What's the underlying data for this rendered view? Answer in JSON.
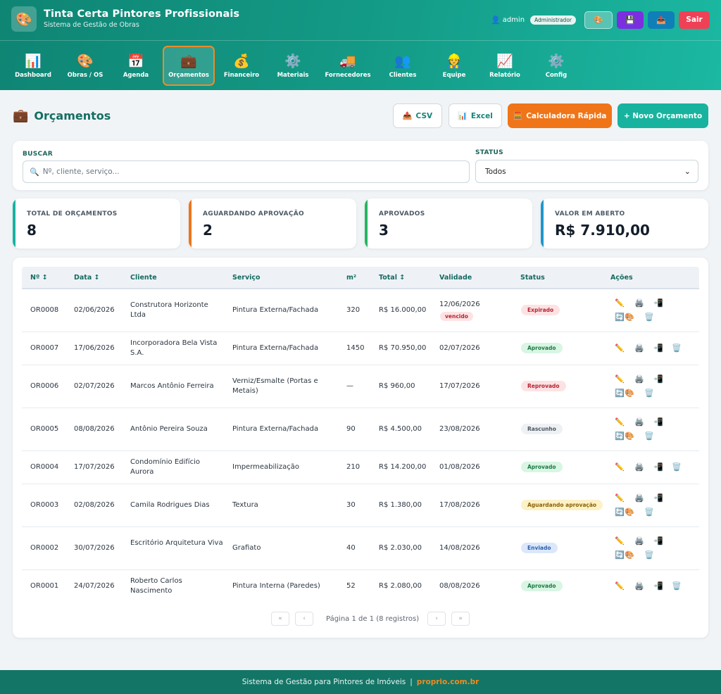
{
  "app": {
    "logo_icon": "🎨",
    "title": "Tinta Certa Pintores Profissionais",
    "subtitle": "Sistema de Gestão de Obras"
  },
  "user": {
    "icon": "👤",
    "name": "admin",
    "role": "Administrador"
  },
  "header_buttons": {
    "theme_icon": "🎨",
    "save_icon": "💾",
    "upload_icon": "📤",
    "exit_label": "Sair"
  },
  "nav": [
    {
      "icon": "📊",
      "label": "Dashboard"
    },
    {
      "icon": "🎨",
      "label": "Obras / OS"
    },
    {
      "icon": "📅",
      "label": "Agenda"
    },
    {
      "icon": "💼",
      "label": "Orçamentos"
    },
    {
      "icon": "💰",
      "label": "Financeiro"
    },
    {
      "icon": "⚙️",
      "label": "Materiais"
    },
    {
      "icon": "🚚",
      "label": "Fornecedores"
    },
    {
      "icon": "👥",
      "label": "Clientes"
    },
    {
      "icon": "👷",
      "label": "Equipe"
    },
    {
      "icon": "📈",
      "label": "Relatório"
    },
    {
      "icon": "⚙️",
      "label": "Config"
    }
  ],
  "page": {
    "icon": "💼",
    "title": "Orçamentos",
    "buttons": {
      "csv_icon": "📤",
      "csv": "CSV",
      "excel_icon": "📊",
      "excel": "Excel",
      "calc_icon": "🧮",
      "calc": "Calculadora Rápida",
      "new": "+ Novo Orçamento"
    }
  },
  "filters": {
    "search_label": "BUSCAR",
    "search_icon": "🔍",
    "search_placeholder": "Nº, cliente, serviço...",
    "search_value": "",
    "status_label": "STATUS",
    "status_value": "Todos",
    "chevron_icon": "⌄"
  },
  "stats": [
    {
      "label": "TOTAL DE ORÇAMENTOS",
      "value": "8"
    },
    {
      "label": "AGUARDANDO APROVAÇÃO",
      "value": "2"
    },
    {
      "label": "APROVADOS",
      "value": "3"
    },
    {
      "label": "VALOR EM ABERTO",
      "value": "R$ 7.910,00"
    }
  ],
  "table": {
    "headers": [
      "Nº ↕",
      "Data ↕",
      "Cliente",
      "Serviço",
      "m²",
      "Total ↕",
      "Validade",
      "Status",
      "Ações"
    ],
    "action_icons": {
      "edit": "✏️",
      "print": "🖨️",
      "convert": "📲",
      "dup": "🔄",
      "theme": "🎨",
      "delete": "🗑️"
    },
    "rows": [
      {
        "num": "OR0008",
        "date": "02/06/2026",
        "client": "Construtora Horizonte Ltda",
        "service": "Pintura Externa/Fachada",
        "m2": "320",
        "total": "R$ 16.000,00",
        "validity": "12/06/2026",
        "expired_note": "vencido",
        "status": "Expirado",
        "status_class": "b-expirado"
      },
      {
        "num": "OR0007",
        "date": "17/06/2026",
        "client": "Incorporadora Bela Vista S.A.",
        "service": "Pintura Externa/Fachada",
        "m2": "1450",
        "total": "R$ 70.950,00",
        "validity": "02/07/2026",
        "status": "Aprovado",
        "status_class": "b-aprovado"
      },
      {
        "num": "OR0006",
        "date": "02/07/2026",
        "client": "Marcos Antônio Ferreira",
        "service": "Verniz/Esmalte (Portas e Metais)",
        "m2": "—",
        "total": "R$ 960,00",
        "validity": "17/07/2026",
        "status": "Reprovado",
        "status_class": "b-reprovado"
      },
      {
        "num": "OR0005",
        "date": "08/08/2026",
        "client": "Antônio Pereira Souza",
        "service": "Pintura Externa/Fachada",
        "m2": "90",
        "total": "R$ 4.500,00",
        "validity": "23/08/2026",
        "status": "Rascunho",
        "status_class": "b-rascunho"
      },
      {
        "num": "OR0004",
        "date": "17/07/2026",
        "client": "Condomínio Edifício Aurora",
        "service": "Impermeabilização",
        "m2": "210",
        "total": "R$ 14.200,00",
        "validity": "01/08/2026",
        "status": "Aprovado",
        "status_class": "b-aprovado"
      },
      {
        "num": "OR0003",
        "date": "02/08/2026",
        "client": "Camila Rodrigues Dias",
        "service": "Textura",
        "m2": "30",
        "total": "R$ 1.380,00",
        "validity": "17/08/2026",
        "status": "Aguardando aprovação",
        "status_class": "b-aguardando"
      },
      {
        "num": "OR0002",
        "date": "30/07/2026",
        "client": "Escritório Arquitetura Viva",
        "service": "Grafiato",
        "m2": "40",
        "total": "R$ 2.030,00",
        "validity": "14/08/2026",
        "status": "Enviado",
        "status_class": "b-enviado"
      },
      {
        "num": "OR0001",
        "date": "24/07/2026",
        "client": "Roberto Carlos Nascimento",
        "service": "Pintura Interna (Paredes)",
        "m2": "52",
        "total": "R$ 2.080,00",
        "validity": "08/08/2026",
        "status": "Aprovado",
        "status_class": "b-aprovado"
      }
    ]
  },
  "pagination": {
    "first": "«",
    "prev": "‹",
    "next": "›",
    "last": "»",
    "info": "Página 1 de 1 (8 registros)"
  },
  "footer": {
    "text": "Sistema de Gestão para Pintores de Imóveis",
    "sep": "|",
    "link": "proprio.com.br"
  }
}
